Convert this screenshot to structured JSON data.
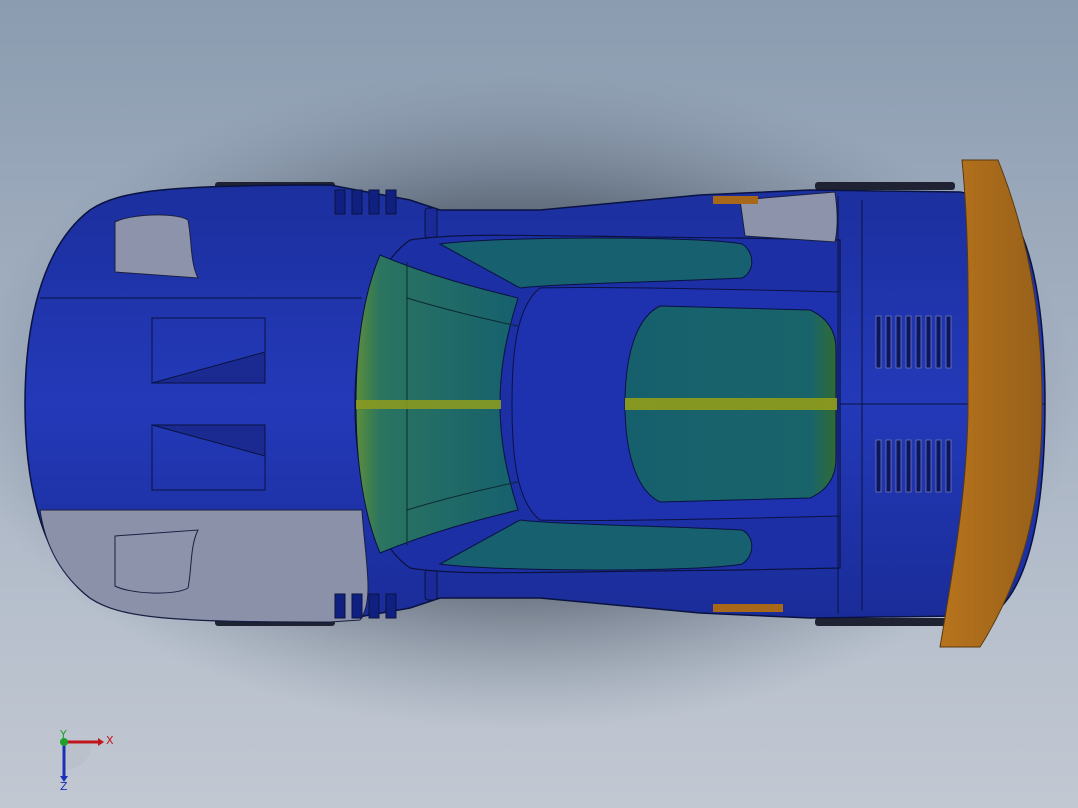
{
  "triad": {
    "x_label": "X",
    "y_label": "Y",
    "z_label": "Z",
    "x_color": "#c0161b",
    "y_color": "#1ea12a",
    "z_color": "#1b2fb8"
  },
  "colors": {
    "body": "#1a2fa8",
    "body_light": "#2a44c4",
    "body_dark": "#0c1a6e",
    "panel_grey": "#8c93ab",
    "glass": "#17606f",
    "glass_edge": "#3a7c3a",
    "stripe": "#8c9a1e",
    "wing": "#a8681a",
    "wing_dark": "#7d4a10"
  }
}
